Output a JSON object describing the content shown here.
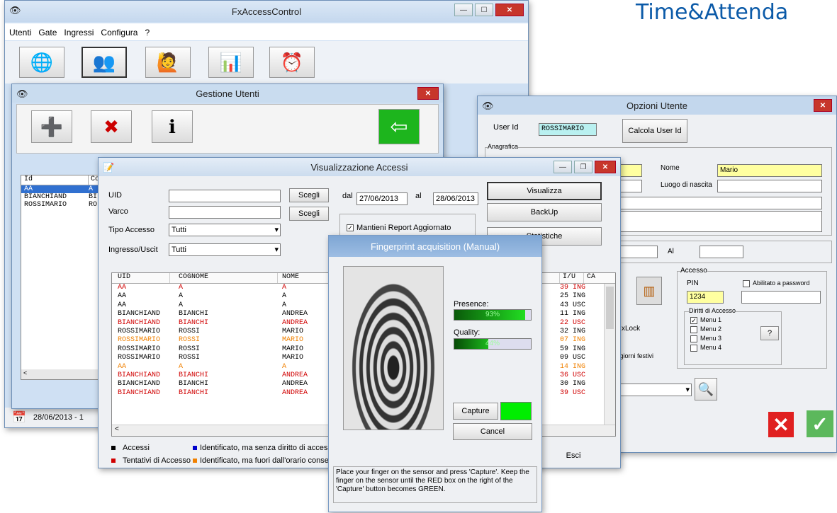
{
  "heading": "Time&Attenda",
  "main": {
    "title": "FxAccessControl",
    "menu": [
      "Utenti",
      "Gate",
      "Ingressi",
      "Configura",
      "?"
    ],
    "status": "28/06/2013 - 1"
  },
  "gestione": {
    "title": "Gestione Utenti",
    "columns": [
      "Id",
      "Co"
    ],
    "rows": [
      [
        "AA",
        "A"
      ],
      [
        "BIANCHIAND",
        "BI"
      ],
      [
        "ROSSIMARIO",
        "RO"
      ]
    ]
  },
  "opzioni": {
    "title": "Opzioni Utente",
    "userid_label": "User Id",
    "userid_value": "ROSSIMARIO",
    "calc_button": "Calcola User Id",
    "anagrafica": "Anagrafica",
    "nome_label": "Nome",
    "nome_value": "Mario",
    "luogo_label": "Luogo di nascita",
    "al_label": "Al",
    "accesso": "Accesso",
    "pin_label": "PIN",
    "pin_value": "1234",
    "abilitato": "Abilitato a password",
    "diritti": "Diritti di Accesso",
    "menus": [
      "Menu 1",
      "Menu 2",
      "Menu 3",
      "Menu 4"
    ],
    "question": "?",
    "xlock": "xLock",
    "festivi": "i giorni festivi"
  },
  "visual": {
    "title": "Visualizzazione Accessi",
    "uid_label": "UID",
    "varco_label": "Varco",
    "tipo_label": "Tipo Accesso",
    "tipo_value": "Tutti",
    "ingresso_label": "Ingresso/Uscit",
    "ingresso_value": "Tutti",
    "scegli": "Scegli",
    "dal": "dal",
    "dal_value": "27/06/2013",
    "al": "al",
    "al_value": "28/06/2013",
    "mantieni": "Mantieni Report Aggiornato",
    "visualizza": "Visualizza",
    "backup": "BackUp",
    "statistiche": "Statistiche",
    "esci": "Esci",
    "columns": [
      "UID",
      "COGNOME",
      "NOME"
    ],
    "right_columns": [
      "I/U",
      "CA"
    ],
    "rows": [
      {
        "uid": "AA",
        "cog": "A",
        "nome": "A",
        "n": "39",
        "io": "ING",
        "color": "#d00000"
      },
      {
        "uid": "AA",
        "cog": "A",
        "nome": "A",
        "n": "25",
        "io": "ING",
        "color": "#000000"
      },
      {
        "uid": "AA",
        "cog": "A",
        "nome": "A",
        "n": "43",
        "io": "USC",
        "color": "#000000"
      },
      {
        "uid": "BIANCHIAND",
        "cog": "BIANCHI",
        "nome": "ANDREA",
        "n": "11",
        "io": "ING",
        "color": "#000000"
      },
      {
        "uid": "BIANCHIAND",
        "cog": "BIANCHI",
        "nome": "ANDREA",
        "n": "22",
        "io": "USC",
        "color": "#d00000"
      },
      {
        "uid": "ROSSIMARIO",
        "cog": "ROSSI",
        "nome": "MARIO",
        "n": "32",
        "io": "ING",
        "color": "#000000"
      },
      {
        "uid": "ROSSIMARIO",
        "cog": "ROSSI",
        "nome": "MARIO",
        "n": "07",
        "io": "ING",
        "color": "#f08000"
      },
      {
        "uid": "ROSSIMARIO",
        "cog": "ROSSI",
        "nome": "MARIO",
        "n": "59",
        "io": "ING",
        "color": "#000000"
      },
      {
        "uid": "ROSSIMARIO",
        "cog": "ROSSI",
        "nome": "MARIO",
        "n": "09",
        "io": "USC",
        "color": "#000000"
      },
      {
        "uid": "AA",
        "cog": "A",
        "nome": "A",
        "n": "14",
        "io": "ING",
        "color": "#f08000"
      },
      {
        "uid": "BIANCHIAND",
        "cog": "BIANCHI",
        "nome": "ANDREA",
        "n": "36",
        "io": "USC",
        "color": "#d00000"
      },
      {
        "uid": "BIANCHIAND",
        "cog": "BIANCHI",
        "nome": "ANDREA",
        "n": "30",
        "io": "ING",
        "color": "#000000"
      },
      {
        "uid": "BIANCHIAND",
        "cog": "BIANCHI",
        "nome": "ANDREA",
        "n": "39",
        "io": "USC",
        "color": "#d00000"
      }
    ],
    "legend": [
      {
        "label": "Accessi",
        "color": "#000000"
      },
      {
        "label": "Identificato, ma senza diritto di accesso",
        "color": "#0000cc"
      },
      {
        "label": "Tentativi di Accesso",
        "color": "#d00000"
      },
      {
        "label": "Identificato, ma fuori dall'orario consenti",
        "color": "#f08000"
      }
    ]
  },
  "finger": {
    "title": "Fingerprint acquisition (Manual)",
    "presence_label": "Presence:",
    "presence_value": "93%",
    "presence_fill": 0.93,
    "quality_label": "Quality:",
    "quality_value": "44%",
    "quality_fill": 0.44,
    "capture": "Capture",
    "cancel": "Cancel",
    "instructions": "Place your finger on the sensor and press 'Capture'. Keep the finger on the sensor until the RED box on the right of the 'Capture' button becomes GREEN."
  }
}
